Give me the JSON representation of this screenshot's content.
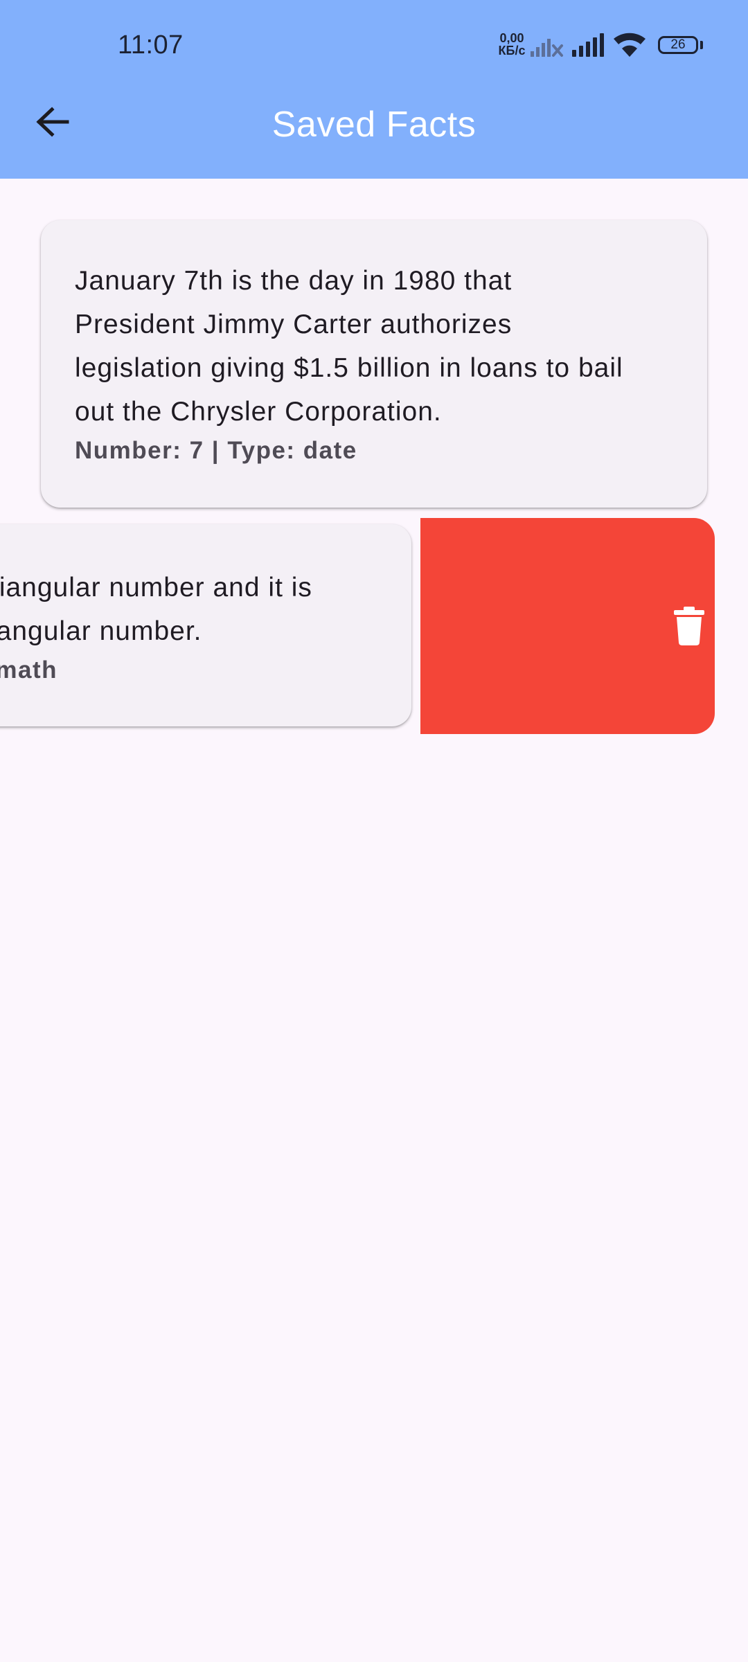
{
  "status_bar": {
    "time": "11:07",
    "net_speed_value": "0,00",
    "net_speed_unit": "КБ/с",
    "battery_level": "26"
  },
  "toolbar": {
    "title": "Saved Facts",
    "back_icon": "arrow-back-icon"
  },
  "facts": [
    {
      "text": "January 7th is the day in 1980 that President Jimmy Carter authorizes legislation giving $1.5 billion in loans to bail out the Chrysler Corporation.",
      "lines": [
        "January 7th is the day in 1980 that",
        "President Jimmy Carter authorizes",
        "legislation giving $1.5 billion in loans to bail",
        "out the Chrysler Corporation."
      ],
      "meta": "Number: 7 | Type: date"
    },
    {
      "visible_lines": [
        "triangular number and it is",
        "riangular number."
      ],
      "meta_visible": ": math"
    }
  ],
  "swipe_action": {
    "icon": "trash-icon",
    "color": "#f44538"
  },
  "colors": {
    "appbar": "#82b0fc",
    "background": "#fcf6fd",
    "card": "#f4f0f6",
    "delete": "#f44538"
  }
}
